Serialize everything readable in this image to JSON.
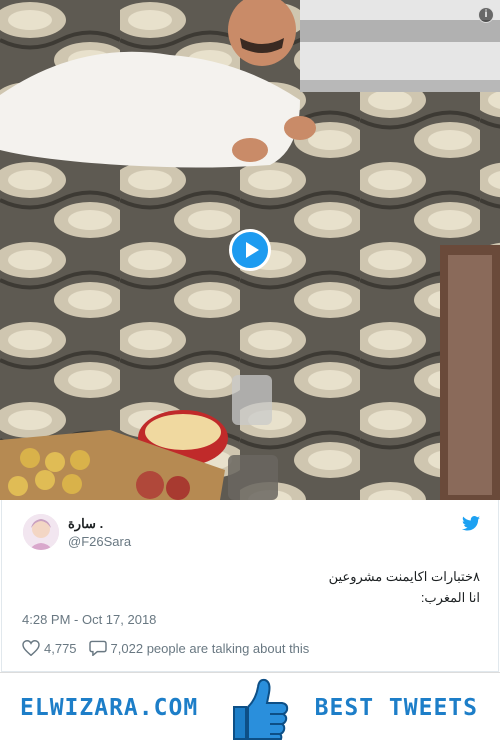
{
  "tweet": {
    "display_name": "سارة .",
    "handle": "@F26Sara",
    "text_line1": "٨ختبارات اكايمنت مشروعين",
    "text_line2": "انا المغرب:",
    "timestamp": "4:28 PM - Oct 17, 2018",
    "like_count": "4,775",
    "talking_text": "7,022 people are talking about this"
  },
  "banner": {
    "left_text": "ELWIZARA.COM",
    "right_text": "BEST TWEETS"
  },
  "colors": {
    "accent": "#1d9bf0",
    "brand": "#1d7ec8"
  },
  "icons": [
    "info-icon",
    "play-icon",
    "twitter-bird-icon",
    "heart-icon",
    "comment-icon",
    "thumbs-up-icon"
  ]
}
